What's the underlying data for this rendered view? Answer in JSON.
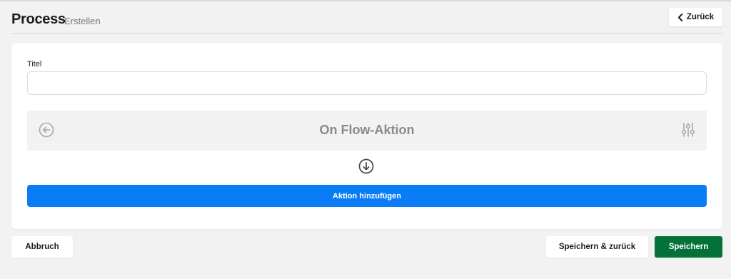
{
  "header": {
    "title": "Process",
    "subtitle": "Erstellen",
    "back_label": "Zurück"
  },
  "form": {
    "title_label": "Titel",
    "title_value": "",
    "title_placeholder": ""
  },
  "flow": {
    "title": "On Flow-Aktion",
    "add_action_label": "Aktion hinzufügen"
  },
  "footer": {
    "cancel_label": "Abbruch",
    "save_back_label": "Speichern & zurück",
    "save_label": "Speichern"
  },
  "icons": {
    "back": "chevron-left-icon",
    "flow_back": "arrow-left-circle-icon",
    "flow_settings": "sliders-icon",
    "connector": "arrow-down-circle-icon"
  },
  "colors": {
    "primary": "#0a7cf6",
    "success": "#047139",
    "muted_icon": "#a8a8a8"
  }
}
